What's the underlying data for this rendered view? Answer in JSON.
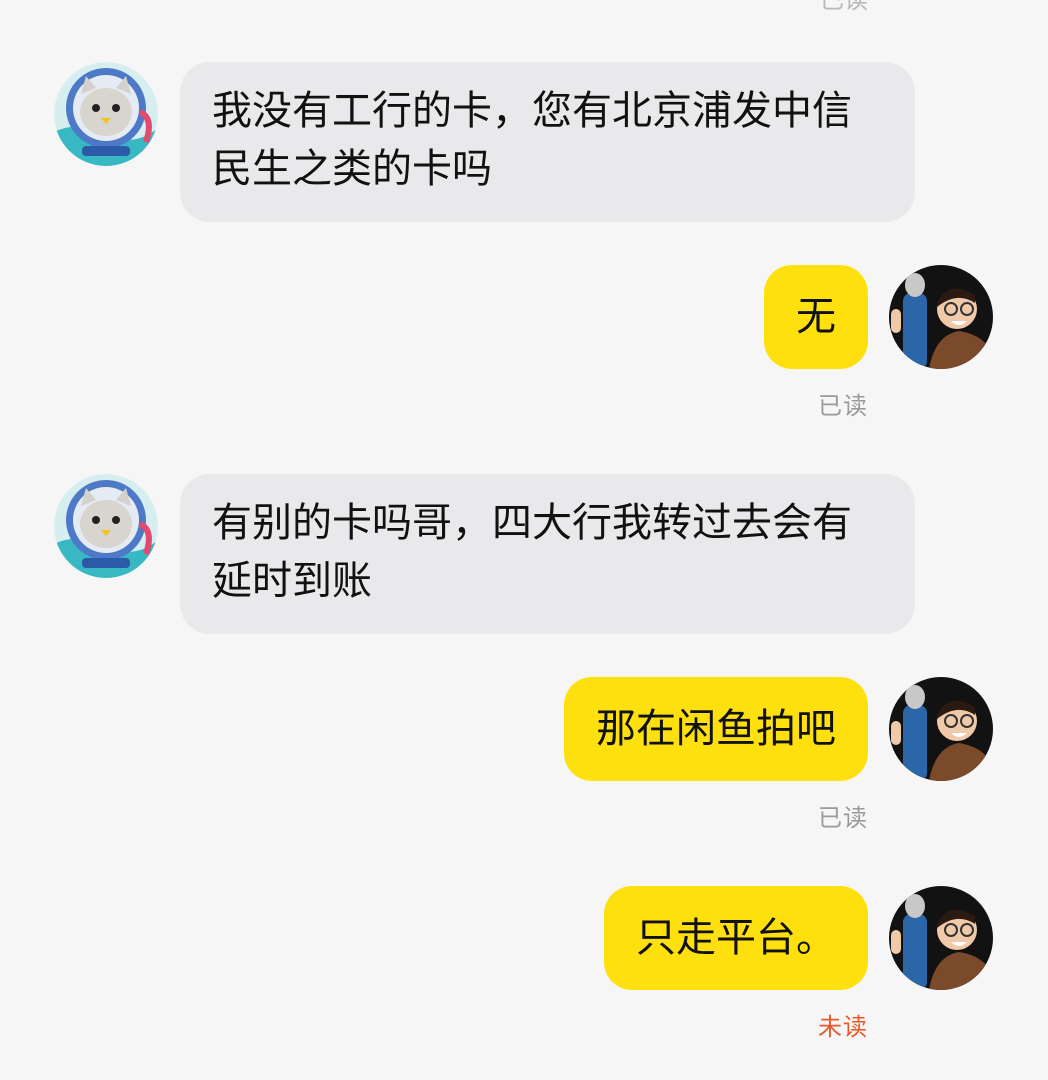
{
  "messages": [
    {
      "side": "in",
      "text": "我没有工行的卡，您有北京浦发中信民生之类的卡吗"
    },
    {
      "side": "out",
      "text": "无",
      "status": "已读"
    },
    {
      "side": "in",
      "text": "有别的卡吗哥，四大行我转过去会有延时到账"
    },
    {
      "side": "out",
      "text": "那在闲鱼拍吧",
      "status": "已读"
    },
    {
      "side": "out",
      "text": "只走平台。",
      "status": "未读"
    }
  ],
  "colors": {
    "background": "#f6f6f6",
    "incoming_bubble": "#e9e9eb",
    "outgoing_bubble": "#ffe00f",
    "read_status": "#9a9a9a",
    "unread_status": "#e95a2b"
  },
  "icons": {
    "contact_avatar": "cat-astronaut-avatar",
    "my_avatar": "man-with-microphone-avatar"
  }
}
